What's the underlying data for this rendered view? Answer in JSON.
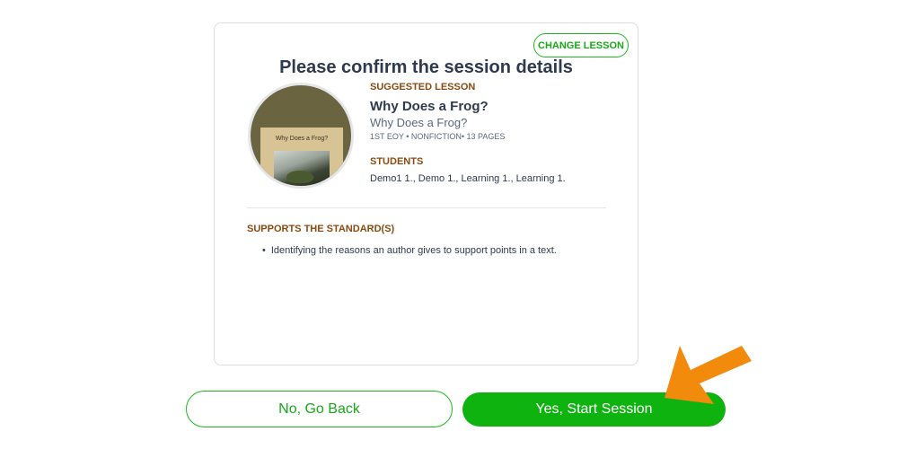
{
  "header": {
    "change_lesson_label": "CHANGE LESSON",
    "title": "Please confirm the session details"
  },
  "lesson": {
    "section_label": "SUGGESTED LESSON",
    "title": "Why Does a Frog?",
    "subtitle": "Why Does a Frog?",
    "meta": "1ST EOY • NONFICTION• 13 PAGES",
    "cover_title": "Why Does a Frog?"
  },
  "students": {
    "section_label": "STUDENTS",
    "names": "Demo1 1., Demo 1., Learning 1., Learning 1."
  },
  "standards": {
    "section_label": "SUPPORTS THE STANDARD(S)",
    "items": [
      "Identifying the reasons an author gives to support points in a text."
    ]
  },
  "actions": {
    "back_label": "No, Go Back",
    "start_label": "Yes, Start Session"
  },
  "colors": {
    "accent_green": "#0fb30f",
    "label_brown": "#8a4a10",
    "arrow_orange": "#f28a0c"
  }
}
